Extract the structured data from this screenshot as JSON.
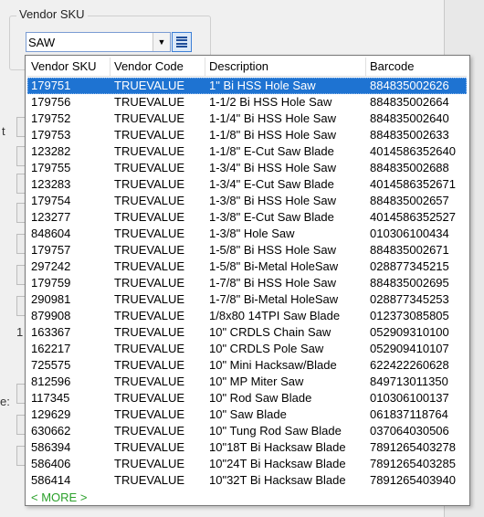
{
  "groupbox": {
    "title": "Vendor SKU"
  },
  "combo": {
    "value": "SAW"
  },
  "icons": {
    "dropdown": "chevron-down-icon",
    "list_button": "list-icon",
    "cursor": "mouse-pointer-icon"
  },
  "side": {
    "char1": "t",
    "char2": "1",
    "char3": "e:"
  },
  "dropdown": {
    "columns": [
      "Vendor SKU",
      "Vendor Code",
      "Description",
      "Barcode"
    ],
    "selected_index": 0,
    "rows": [
      {
        "sku": "179751",
        "code": "TRUEVALUE",
        "desc": "1\" Bi HSS Hole Saw",
        "barcode": "884835002626"
      },
      {
        "sku": "179756",
        "code": "TRUEVALUE",
        "desc": "1-1/2 Bi HSS Hole Saw",
        "barcode": "884835002664"
      },
      {
        "sku": "179752",
        "code": "TRUEVALUE",
        "desc": "1-1/4\" Bi HSS Hole Saw",
        "barcode": "884835002640"
      },
      {
        "sku": "179753",
        "code": "TRUEVALUE",
        "desc": "1-1/8\" Bi HSS Hole Saw",
        "barcode": "884835002633"
      },
      {
        "sku": "123282",
        "code": "TRUEVALUE",
        "desc": "1-1/8\" E-Cut Saw Blade",
        "barcode": "4014586352640"
      },
      {
        "sku": "179755",
        "code": "TRUEVALUE",
        "desc": "1-3/4\" Bi HSS Hole Saw",
        "barcode": "884835002688"
      },
      {
        "sku": "123283",
        "code": "TRUEVALUE",
        "desc": "1-3/4\" E-Cut Saw Blade",
        "barcode": "4014586352671"
      },
      {
        "sku": "179754",
        "code": "TRUEVALUE",
        "desc": "1-3/8\" Bi HSS Hole Saw",
        "barcode": "884835002657"
      },
      {
        "sku": "123277",
        "code": "TRUEVALUE",
        "desc": "1-3/8\" E-Cut Saw Blade",
        "barcode": "4014586352527"
      },
      {
        "sku": "848604",
        "code": "TRUEVALUE",
        "desc": "1-3/8\" Hole Saw",
        "barcode": "010306100434"
      },
      {
        "sku": "179757",
        "code": "TRUEVALUE",
        "desc": "1-5/8\" Bi HSS Hole Saw",
        "barcode": "884835002671"
      },
      {
        "sku": "297242",
        "code": "TRUEVALUE",
        "desc": "1-5/8\" Bi-Metal HoleSaw",
        "barcode": "028877345215"
      },
      {
        "sku": "179759",
        "code": "TRUEVALUE",
        "desc": "1-7/8\" Bi HSS Hole Saw",
        "barcode": "884835002695"
      },
      {
        "sku": "290981",
        "code": "TRUEVALUE",
        "desc": "1-7/8\" Bi-Metal HoleSaw",
        "barcode": "028877345253"
      },
      {
        "sku": "879908",
        "code": "TRUEVALUE",
        "desc": "1/8x80 14TPI Saw Blade",
        "barcode": "012373085805"
      },
      {
        "sku": "163367",
        "code": "TRUEVALUE",
        "desc": "10\" CRDLS Chain Saw",
        "barcode": "052909310100"
      },
      {
        "sku": "162217",
        "code": "TRUEVALUE",
        "desc": "10\" CRDLS Pole Saw",
        "barcode": "052909410107"
      },
      {
        "sku": "725575",
        "code": "TRUEVALUE",
        "desc": "10\" Mini Hacksaw/Blade",
        "barcode": "622422260628"
      },
      {
        "sku": "812596",
        "code": "TRUEVALUE",
        "desc": "10\" MP Miter Saw",
        "barcode": "849713011350"
      },
      {
        "sku": "117345",
        "code": "TRUEVALUE",
        "desc": "10\" Rod Saw Blade",
        "barcode": "010306100137"
      },
      {
        "sku": "129629",
        "code": "TRUEVALUE",
        "desc": "10\" Saw Blade",
        "barcode": "061837118764"
      },
      {
        "sku": "630662",
        "code": "TRUEVALUE",
        "desc": "10\" Tung Rod Saw Blade",
        "barcode": "037064030506"
      },
      {
        "sku": "586394",
        "code": "TRUEVALUE",
        "desc": "10\"18T Bi Hacksaw Blade",
        "barcode": "7891265403278"
      },
      {
        "sku": "586406",
        "code": "TRUEVALUE",
        "desc": "10\"24T Bi Hacksaw Blade",
        "barcode": "7891265403285"
      },
      {
        "sku": "586414",
        "code": "TRUEVALUE",
        "desc": "10\"32T Bi Hacksaw Blade",
        "barcode": "7891265403940"
      }
    ],
    "more_label": "< MORE >"
  }
}
